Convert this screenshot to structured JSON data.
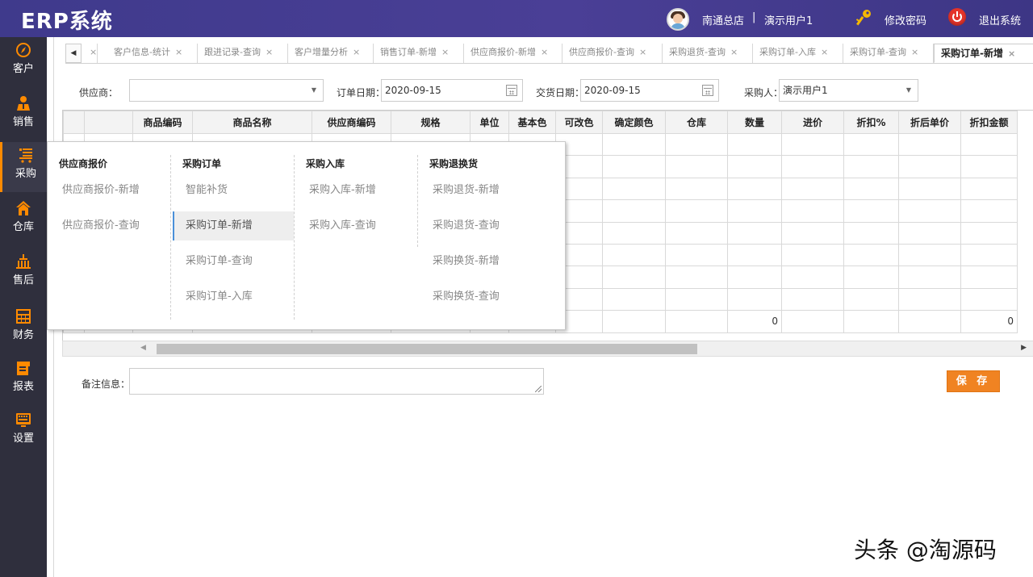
{
  "app": {
    "title": "ERP系统"
  },
  "header": {
    "store": "南通总店",
    "separator": "|",
    "user": "演示用户1",
    "change_password": "修改密码",
    "logout": "退出系统"
  },
  "sidebar": {
    "items": [
      {
        "label": "客户",
        "icon": "compass-icon"
      },
      {
        "label": "销售",
        "icon": "salesperson-icon"
      },
      {
        "label": "采购",
        "icon": "shopping-cart-icon",
        "active": true
      },
      {
        "label": "仓库",
        "icon": "house-icon"
      },
      {
        "label": "售后",
        "icon": "service-icon"
      },
      {
        "label": "财务",
        "icon": "calculator-icon"
      },
      {
        "label": "报表",
        "icon": "report-icon"
      },
      {
        "label": "设置",
        "icon": "keyboard-icon"
      }
    ]
  },
  "tabs": [
    {
      "label": "客户信息-统计"
    },
    {
      "label": "跟进记录-查询"
    },
    {
      "label": "客户增量分析"
    },
    {
      "label": "销售订单-新增"
    },
    {
      "label": "供应商报价-新增"
    },
    {
      "label": "供应商报价-查询"
    },
    {
      "label": "采购退货-查询"
    },
    {
      "label": "采购订单-入库"
    },
    {
      "label": "采购订单-查询"
    },
    {
      "label": "采购订单-新增",
      "active": true
    }
  ],
  "form": {
    "supplier_label": "供应商：",
    "supplier_value": "",
    "order_date_label": "订单日期：",
    "order_date_value": "2020-09-15",
    "delivery_date_label": "交货日期：",
    "delivery_date_value": "2020-09-15",
    "buyer_label": "采购人：",
    "buyer_value": "演示用户1"
  },
  "grid": {
    "columns": [
      "商品编码",
      "商品名称",
      "供应商编码",
      "规格",
      "单位",
      "基本色",
      "可改色",
      "确定颜色",
      "仓库",
      "数量",
      "进价",
      "折扣%",
      "折后单价",
      "折扣金额"
    ],
    "footer": {
      "quantity_total": "0",
      "discount_amount_total": "0"
    }
  },
  "remarks": {
    "label": "备注信息：",
    "value": ""
  },
  "save_button": "保 存",
  "mega_menu": {
    "columns": [
      {
        "title": "供应商报价",
        "items": [
          "供应商报价-新增",
          "供应商报价-查询"
        ]
      },
      {
        "title": "采购订单",
        "items": [
          "智能补货",
          "采购订单-新增",
          "采购订单-查询",
          "采购订单-入库"
        ],
        "selected": "采购订单-新增"
      },
      {
        "title": "采购入库",
        "items": [
          "采购入库-新增",
          "采购入库-查询"
        ]
      },
      {
        "title": "采购退换货",
        "items": [
          "采购退货-新增",
          "采购退货-查询",
          "采购换货-新增",
          "采购换货-查询"
        ]
      }
    ]
  },
  "watermark": "头条 @淘源码",
  "colors": {
    "header_bg": "#43398f",
    "sidebar_bg": "#2f2f3d",
    "accent_orange": "#f08322",
    "menu_selected_border": "#4a90d9"
  }
}
